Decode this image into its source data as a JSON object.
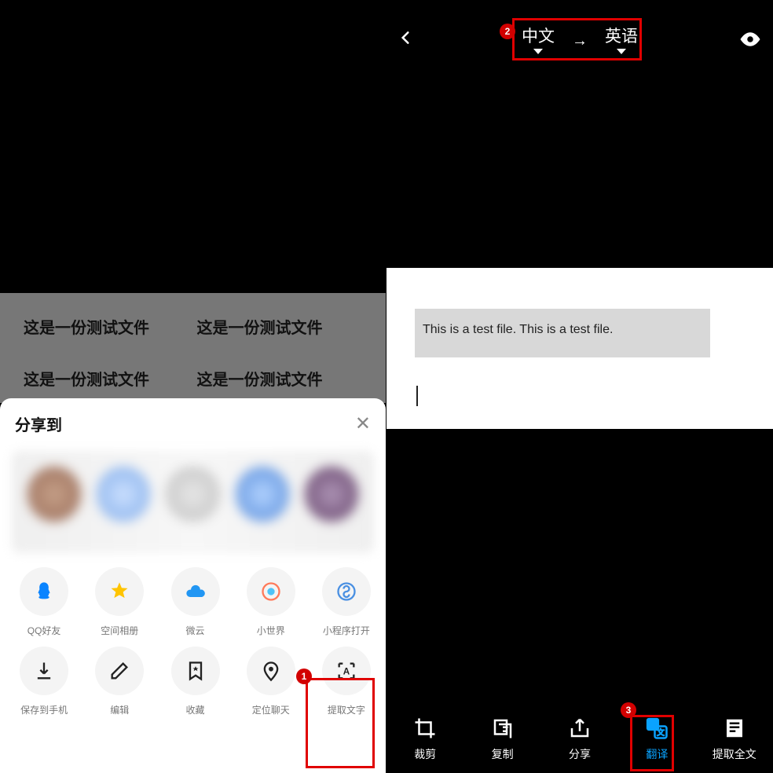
{
  "left": {
    "dim_lines": [
      "这是一份测试文件",
      "这是一份测试文件",
      "这是一份测试文件",
      "这是一份测试文件"
    ],
    "sheet_title": "分享到",
    "share_row1": [
      {
        "icon": "qq",
        "label": "QQ好友"
      },
      {
        "icon": "qzone",
        "label": "空间相册"
      },
      {
        "icon": "weiyun",
        "label": "微云"
      },
      {
        "icon": "world",
        "label": "小世界"
      },
      {
        "icon": "mini",
        "label": "小程序打开"
      }
    ],
    "share_row2": [
      {
        "icon": "download",
        "label": "保存到手机"
      },
      {
        "icon": "edit",
        "label": "编辑"
      },
      {
        "icon": "star",
        "label": "收藏"
      },
      {
        "icon": "locate",
        "label": "定位聊天"
      },
      {
        "icon": "ocr",
        "label": "提取文字"
      }
    ],
    "badge1": "1"
  },
  "right": {
    "lang_from": "中文",
    "lang_to": "英语",
    "badge2": "2",
    "translated_text": "This is a test file. This is a test file.",
    "tools": [
      {
        "key": "crop",
        "label": "裁剪"
      },
      {
        "key": "copy",
        "label": "复制"
      },
      {
        "key": "share",
        "label": "分享"
      },
      {
        "key": "translate",
        "label": "翻译"
      },
      {
        "key": "fulltext",
        "label": "提取全文"
      }
    ],
    "badge3": "3"
  }
}
